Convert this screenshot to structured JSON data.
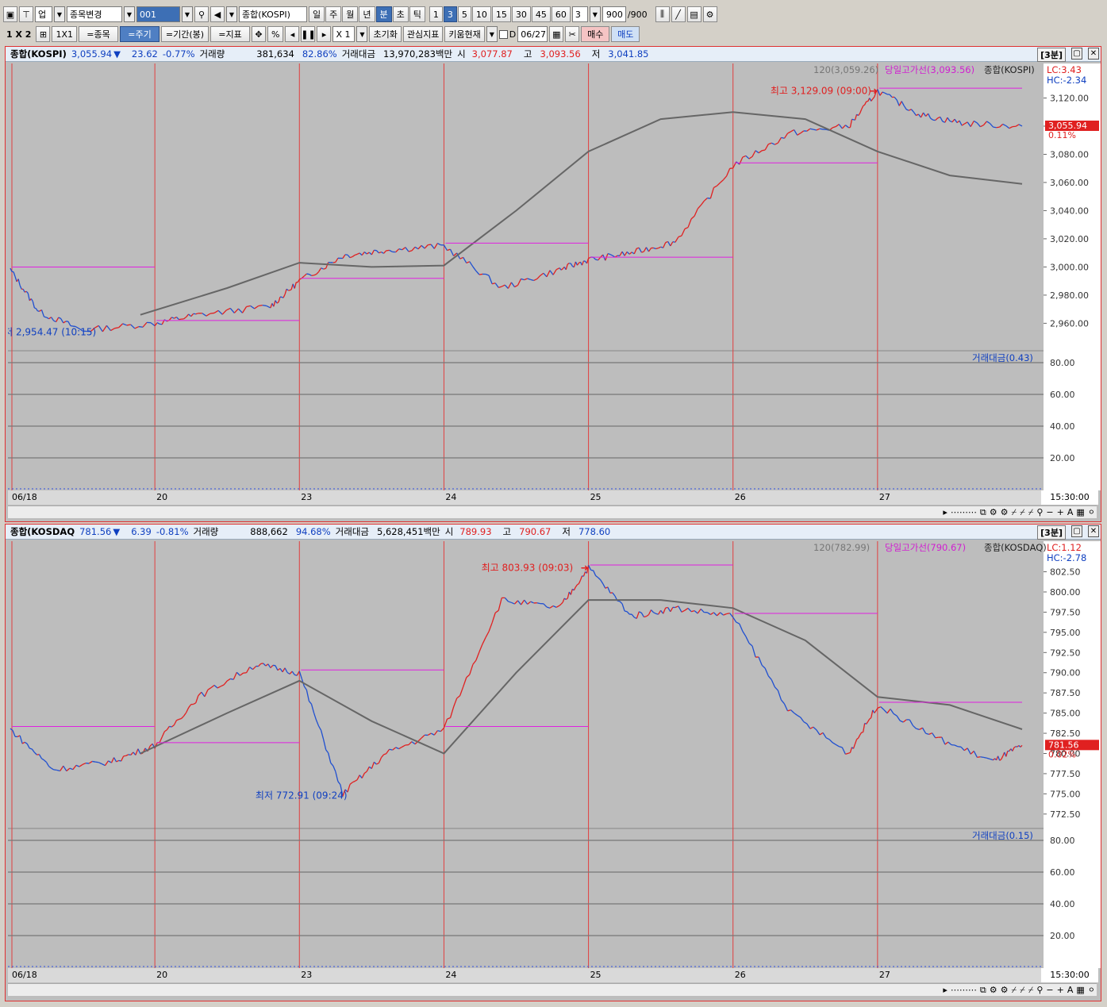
{
  "toolbar1": {
    "market": "업",
    "change_stock": "종목변경",
    "code": "001",
    "name": "종합(KOSPI)",
    "periods": [
      "일",
      "주",
      "월",
      "년",
      "분",
      "초",
      "틱"
    ],
    "active_period": "분",
    "minutes": [
      "1",
      "3",
      "5",
      "10",
      "15",
      "30",
      "45",
      "60"
    ],
    "active_minute": "3",
    "count_value": "3",
    "bar_count": "900",
    "bar_total": "/900"
  },
  "toolbar2": {
    "layout": "1 X 2",
    "layout2": "1X1",
    "stock_btn": "=종목",
    "period_btn": "=주기",
    "range_btn": "=기간(봉)",
    "indicator_btn": "=지표",
    "percent": "%",
    "zoom": "X 1",
    "reset": "초기화",
    "fav_indicator": "관심지표",
    "current": "키움현재",
    "d_label": "D",
    "date": "06/27",
    "buy": "매수",
    "sell": "매도"
  },
  "panels": [
    {
      "name": "종합(KOSPI)",
      "price": "3,055.94",
      "arrow": "▼",
      "change": "23.62",
      "change_pct": "-0.77%",
      "vol_label": "거래량",
      "volume": "381,634",
      "vol_pct": "82.86%",
      "amount_label": "거래대금",
      "amount": "13,970,283백만",
      "open_label": "시",
      "open": "3,077.87",
      "high_label": "고",
      "high": "3,093.56",
      "low_label": "저",
      "low": "3,041.85",
      "timeframe": "[3분]",
      "legend_ma": "120(3,059.26)",
      "legend_high": "당일고가선(3,093.56)",
      "legend_name": "종합(KOSPI)",
      "lc": "LC:3.43",
      "hc": "HC:-2.34",
      "yticks": [
        "3,120.00",
        "3,100.00",
        "3,080.00",
        "3,060.00",
        "3,040.00",
        "3,020.00",
        "3,000.00",
        "2,980.00",
        "2,960.00"
      ],
      "ytick_vals": [
        3120,
        3100,
        3080,
        3060,
        3040,
        3020,
        3000,
        2980,
        2960
      ],
      "ymin": 2945,
      "ymax": 3140,
      "price_tag": "3,055.94",
      "price_tag_pct": "0.11%",
      "max_label": "최고 3,129.09 (09:00)",
      "min_label": "최저 2,954.47 (10:15)",
      "sub_label": "거래대금(0.43)",
      "sub_ticks": [
        "80.00",
        "60.00",
        "40.00",
        "20.00"
      ],
      "xlabels": [
        "06/18",
        "20",
        "23",
        "24",
        "25",
        "26",
        "27"
      ],
      "xtime": "15:30:00"
    },
    {
      "name": "종합(KOSDAQ",
      "price": "781.56",
      "arrow": "▼",
      "change": "6.39",
      "change_pct": "-0.81%",
      "vol_label": "거래량",
      "volume": "888,662",
      "vol_pct": "94.68%",
      "amount_label": "거래대금",
      "amount": "5,628,451백만",
      "open_label": "시",
      "open": "789.93",
      "high_label": "고",
      "high": "790.67",
      "low_label": "저",
      "low": "778.60",
      "timeframe": "[3분]",
      "legend_ma": "120(782.99)",
      "legend_high": "당일고가선(790.67)",
      "legend_name": "종합(KOSDAQ)",
      "lc": "LC:1.12",
      "hc": "HC:-2.78",
      "yticks": [
        "802.50",
        "800.00",
        "797.50",
        "795.00",
        "792.50",
        "790.00",
        "787.50",
        "785.00",
        "782.50",
        "780.00",
        "777.50",
        "775.00",
        "772.50"
      ],
      "ytick_vals": [
        802.5,
        800,
        797.5,
        795,
        792.5,
        790,
        787.5,
        785,
        782.5,
        780,
        777.5,
        775,
        772.5
      ],
      "ymin": 771.5,
      "ymax": 805.5,
      "price_tag": "781.56",
      "price_tag_pct": "0.02%",
      "max_label": "최고 803.93 (09:03)",
      "min_label": "최저 772.91 (09:24)",
      "sub_label": "거래대금(0.15)",
      "sub_ticks": [
        "80.00",
        "60.00",
        "40.00",
        "20.00"
      ],
      "xlabels": [
        "06/18",
        "20",
        "23",
        "24",
        "25",
        "26",
        "27"
      ],
      "xtime": "15:30:00"
    }
  ],
  "chart_data": [
    {
      "type": "line",
      "title": "종합(KOSPI)",
      "series": [
        {
          "name": "종합(KOSPI)",
          "x": [
            0,
            0.2,
            0.5,
            1,
            1.3,
            1.8,
            2,
            2.3,
            2.6,
            3,
            3.4,
            3.8,
            4,
            4.3,
            4.6,
            5,
            5.4,
            5.8,
            6,
            6.3,
            6.6,
            7
          ],
          "values": [
            2998,
            2968,
            2955,
            2960,
            2966,
            2972,
            2990,
            3008,
            3012,
            3015,
            2985,
            2998,
            3005,
            3010,
            3018,
            3072,
            3095,
            3100,
            3125,
            3108,
            3102,
            3100
          ]
        },
        {
          "name": "120",
          "x": [
            0.9,
            1.5,
            2,
            2.5,
            3,
            3.5,
            4,
            4.5,
            5,
            5.5,
            6,
            6.5,
            7
          ],
          "values": [
            2966,
            2985,
            3003,
            3000,
            3001,
            3040,
            3082,
            3105,
            3110,
            3105,
            3082,
            3065,
            3059
          ]
        }
      ],
      "days": [
        "06/18",
        "20",
        "23",
        "24",
        "25",
        "26",
        "27"
      ]
    },
    {
      "type": "line",
      "title": "종합(KOSDAQ)",
      "series": [
        {
          "name": "종합(KOSDAQ",
          "x": [
            0,
            0.3,
            0.7,
            1,
            1.3,
            1.7,
            2,
            2.3,
            2.6,
            3,
            3.4,
            3.8,
            4,
            4.3,
            4.6,
            5,
            5.4,
            5.8,
            6,
            6.4,
            6.8,
            7
          ],
          "values": [
            783,
            778,
            779,
            781,
            787,
            791,
            790,
            775,
            780,
            783,
            799,
            798,
            803,
            797,
            798,
            797,
            785,
            780,
            786,
            782,
            779,
            781
          ]
        },
        {
          "name": "120",
          "x": [
            0.9,
            1.5,
            2,
            2.5,
            3,
            3.5,
            4,
            4.5,
            5,
            5.5,
            6,
            6.5,
            7
          ],
          "values": [
            780,
            785,
            789,
            784,
            780,
            790,
            799,
            799,
            798,
            794,
            787,
            786,
            783
          ]
        }
      ]
    }
  ]
}
